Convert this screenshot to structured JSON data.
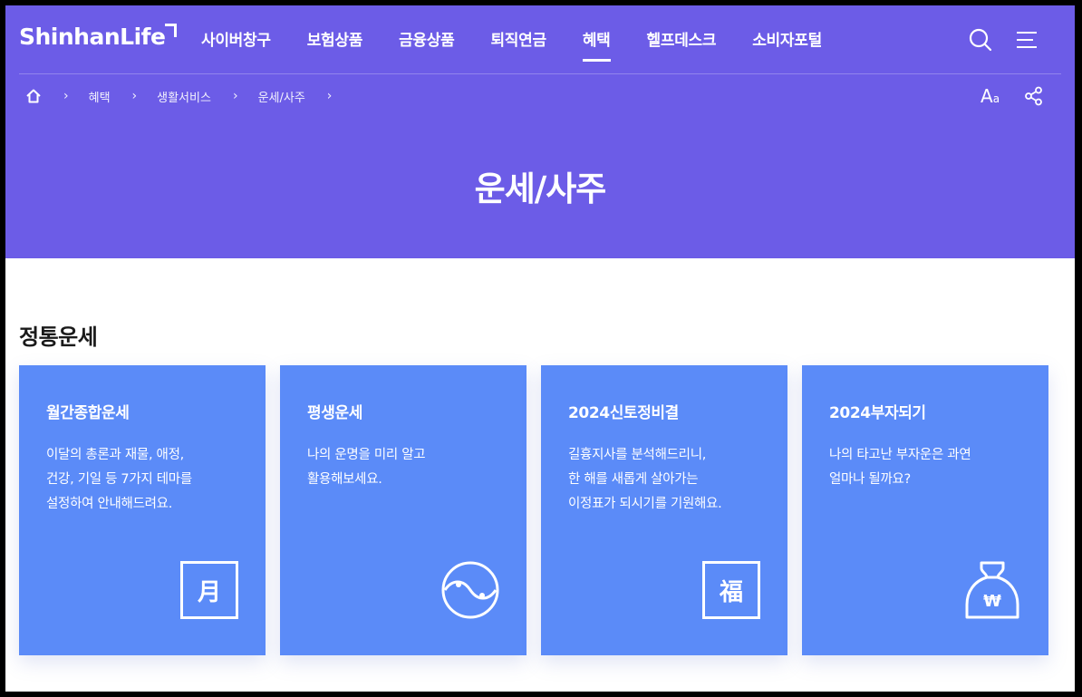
{
  "header": {
    "logo": "ShinhanLife",
    "nav": [
      "사이버창구",
      "보험상품",
      "금융상품",
      "퇴직연금",
      "혜택",
      "헬프데스크",
      "소비자포털"
    ],
    "active_nav": "혜택",
    "icons": [
      "search-icon",
      "menu-icon"
    ]
  },
  "breadcrumb": {
    "home_icon": "home-icon",
    "items": [
      "혜택",
      "생활서비스",
      "운세/사주"
    ]
  },
  "tools": {
    "font_size_label": "A",
    "font_size_small": "a",
    "share_icon": "share-icon"
  },
  "page": {
    "title": "운세/사주"
  },
  "section": {
    "title": "정통운세",
    "cards": [
      {
        "title": "월간종합운세",
        "desc": [
          "이달의 총론과 재물, 애정,",
          "건강, 기일 등 7가지 테마를",
          "설정하여 안내해드려요."
        ],
        "icon_glyph": "月",
        "icon": "moon-character-icon"
      },
      {
        "title": "평생운세",
        "desc": [
          "나의 운명을 미리 알고",
          "활용해보세요."
        ],
        "icon": "yin-yang-icon"
      },
      {
        "title": "2024신토정비결",
        "desc": [
          "길흉지사를 분석해드리니,",
          "한 해를 새롭게 살아가는",
          "이정표가 되시기를 기원해요."
        ],
        "icon_glyph": "福",
        "icon": "fortune-character-icon"
      },
      {
        "title": "2024부자되기",
        "desc": [
          "나의 타고난 부자운은 과연",
          "얼마나 될까요?"
        ],
        "icon_glyph": "₩",
        "icon": "money-bag-icon"
      }
    ]
  },
  "colors": {
    "brand": "#6c5ce7",
    "card": "#5b8bf8"
  }
}
